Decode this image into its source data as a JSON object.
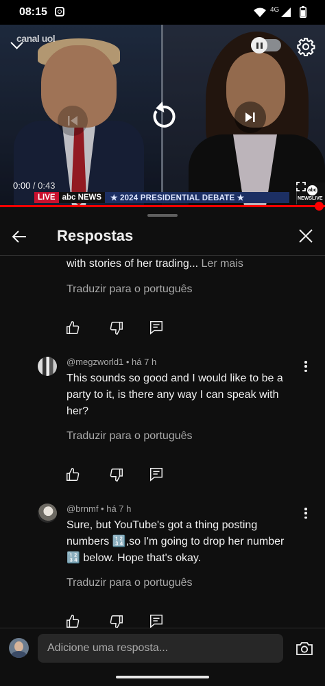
{
  "status_bar": {
    "time": "08:15",
    "network": "4G"
  },
  "video": {
    "channel_logo": "canal uol",
    "current_time": "0:00",
    "separator": " / ",
    "duration": "0:43",
    "progress_fraction": 0.0,
    "ticker": {
      "live": "LIVE",
      "network": "abc NEWS",
      "title": "★ 2024 PRESIDENTIAL DEBATE ★"
    },
    "badge": {
      "logo": "abc",
      "text": "NEWSLIVE"
    },
    "icons": [
      "chevron-down-icon",
      "pause-icon",
      "gear-icon",
      "skip-previous-icon",
      "replay-icon",
      "skip-next-icon",
      "fullscreen-icon"
    ]
  },
  "sheet": {
    "title": "Respostas",
    "icons": [
      "back-arrow-icon",
      "close-icon"
    ]
  },
  "comments": [
    {
      "text_tail": "with stories of her trading... ",
      "more_label": "Ler mais",
      "translate_label": "Traduzir para o português"
    },
    {
      "author": "@megzworld1",
      "time": " • há 7 h",
      "text": "This sounds so good and I would like to be a party to it, is there any way I can speak with her?",
      "translate_label": "Traduzir para o português"
    },
    {
      "author": "@brnmf",
      "time": " • há 7 h",
      "text": "Sure, but YouTube's got a thing posting numbers 🔢,so I'm going to drop her number 🔢 below. Hope that's okay.",
      "translate_label": "Traduzir para o português"
    }
  ],
  "reply_input": {
    "placeholder": "Adicione uma resposta..."
  },
  "colors": {
    "background": "#0f0f0f",
    "accent": "#ff0000",
    "muted_text": "#aaaaaa"
  }
}
